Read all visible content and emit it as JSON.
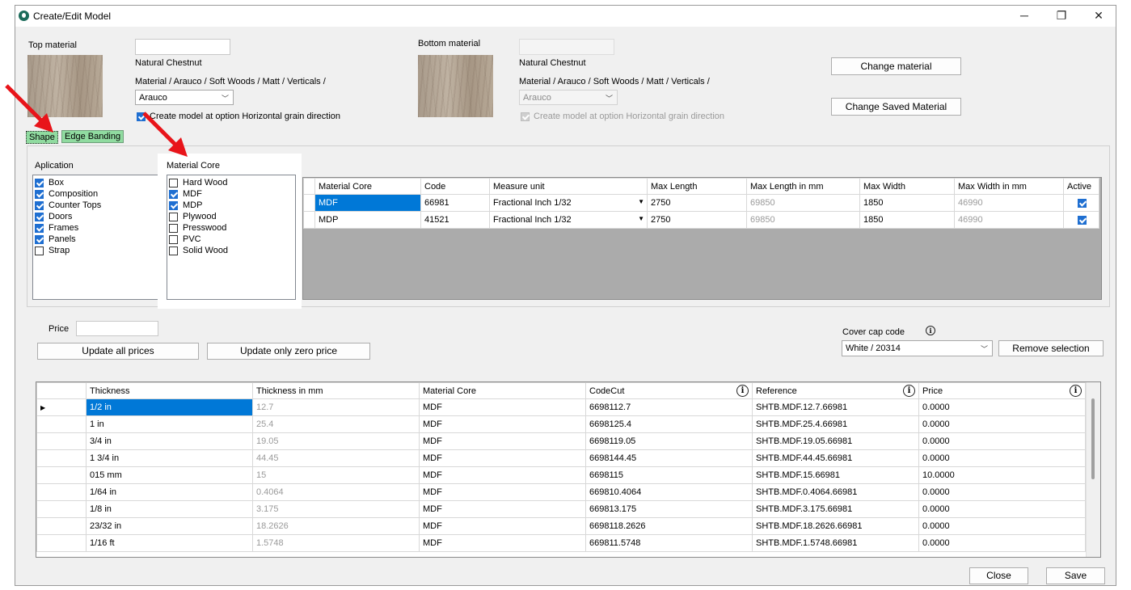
{
  "window": {
    "title": "Create/Edit Model",
    "minimize": "─",
    "maximize": "❐",
    "close": "✕"
  },
  "top_material": {
    "label": "Top material",
    "input_value": "",
    "name": "Natural Chestnut",
    "path": "Material  / Arauco / Soft Woods / Matt / Verticals /",
    "brand_selected": "Arauco",
    "horizontal_grain_label": "Create model at option Horizontal grain direction",
    "horizontal_grain_checked": true
  },
  "bottom_material": {
    "label": "Bottom material",
    "input_value": "",
    "name": "Natural Chestnut",
    "path": "Material  / Arauco / Soft Woods / Matt / Verticals /",
    "brand_selected": "Arauco",
    "horizontal_grain_label": "Create model at option Horizontal grain direction",
    "horizontal_grain_checked": true
  },
  "buttons": {
    "change_material": "Change material",
    "change_saved_material": "Change Saved Material",
    "update_all_prices": "Update all prices",
    "update_zero_price": "Update only zero price",
    "remove_selection": "Remove selection",
    "close": "Close",
    "save": "Save"
  },
  "tabs": [
    {
      "label": "Shape",
      "active": true
    },
    {
      "label": "Edge Banding",
      "active": false
    }
  ],
  "application": {
    "label": "Aplication",
    "items": [
      {
        "label": "Box",
        "checked": true
      },
      {
        "label": "Composition",
        "checked": true
      },
      {
        "label": "Counter Tops",
        "checked": true
      },
      {
        "label": "Doors",
        "checked": true
      },
      {
        "label": "Frames",
        "checked": true
      },
      {
        "label": "Panels",
        "checked": true
      },
      {
        "label": "Strap",
        "checked": false
      }
    ]
  },
  "material_core": {
    "label": "Material Core",
    "items": [
      {
        "label": "Hard Wood",
        "checked": false
      },
      {
        "label": "MDF",
        "checked": true
      },
      {
        "label": "MDP",
        "checked": true
      },
      {
        "label": "Plywood",
        "checked": false
      },
      {
        "label": "Presswood",
        "checked": false
      },
      {
        "label": "PVC",
        "checked": false
      },
      {
        "label": "Solid Wood",
        "checked": false
      }
    ]
  },
  "core_grid": {
    "headers": [
      "Material Core",
      "Code",
      "Measure unit",
      "Max Length",
      "Max Length in mm",
      "Max Width",
      "Max Width in mm",
      "Active"
    ],
    "rows": [
      {
        "core": "MDF",
        "code": "66981",
        "unit": "Fractional Inch 1/32",
        "max_length": "2750",
        "max_length_mm": "69850",
        "max_width": "1850",
        "max_width_mm": "46990",
        "active": true
      },
      {
        "core": "MDP",
        "code": "41521",
        "unit": "Fractional Inch 1/32",
        "max_length": "2750",
        "max_length_mm": "69850",
        "max_width": "1850",
        "max_width_mm": "46990",
        "active": true
      }
    ]
  },
  "price": {
    "label": "Price",
    "value": ""
  },
  "cover_cap": {
    "label": "Cover cap code",
    "selected": "White / 20314",
    "info_icon": "i"
  },
  "thickness_grid": {
    "headers": [
      "Thickness",
      "Thickness in mm",
      "Material Core",
      "CodeCut",
      "Reference",
      "Price"
    ],
    "info_icon": "i",
    "row_indicator": "▶",
    "rows": [
      {
        "thickness": "1/2 in",
        "mm": "12.7",
        "core": "MDF",
        "codecut": "6698112.7",
        "reference": "SHTB.MDF.12.7.66981",
        "price": "0.0000"
      },
      {
        "thickness": "1 in",
        "mm": "25.4",
        "core": "MDF",
        "codecut": "6698125.4",
        "reference": "SHTB.MDF.25.4.66981",
        "price": "0.0000"
      },
      {
        "thickness": "3/4 in",
        "mm": "19.05",
        "core": "MDF",
        "codecut": "6698119.05",
        "reference": "SHTB.MDF.19.05.66981",
        "price": "0.0000"
      },
      {
        "thickness": "1 3/4 in",
        "mm": "44.45",
        "core": "MDF",
        "codecut": "6698144.45",
        "reference": "SHTB.MDF.44.45.66981",
        "price": "0.0000"
      },
      {
        "thickness": "015 mm",
        "mm": "15",
        "core": "MDF",
        "codecut": "6698115",
        "reference": "SHTB.MDF.15.66981",
        "price": "10.0000"
      },
      {
        "thickness": "1/64 in",
        "mm": "0.4064",
        "core": "MDF",
        "codecut": "669810.4064",
        "reference": "SHTB.MDF.0.4064.66981",
        "price": "0.0000"
      },
      {
        "thickness": "1/8 in",
        "mm": "3.175",
        "core": "MDF",
        "codecut": "669813.175",
        "reference": "SHTB.MDF.3.175.66981",
        "price": "0.0000"
      },
      {
        "thickness": "23/32 in",
        "mm": "18.2626",
        "core": "MDF",
        "codecut": "6698118.2626",
        "reference": "SHTB.MDF.18.2626.66981",
        "price": "0.0000"
      },
      {
        "thickness": "1/16 ft",
        "mm": "1.5748",
        "core": "MDF",
        "codecut": "669811.5748",
        "reference": "SHTB.MDF.1.5748.66981",
        "price": "0.0000"
      }
    ]
  },
  "colors": {
    "tab_green": "#90dba0",
    "selection_blue": "#0078d7",
    "annotation_red": "#e8141a"
  }
}
